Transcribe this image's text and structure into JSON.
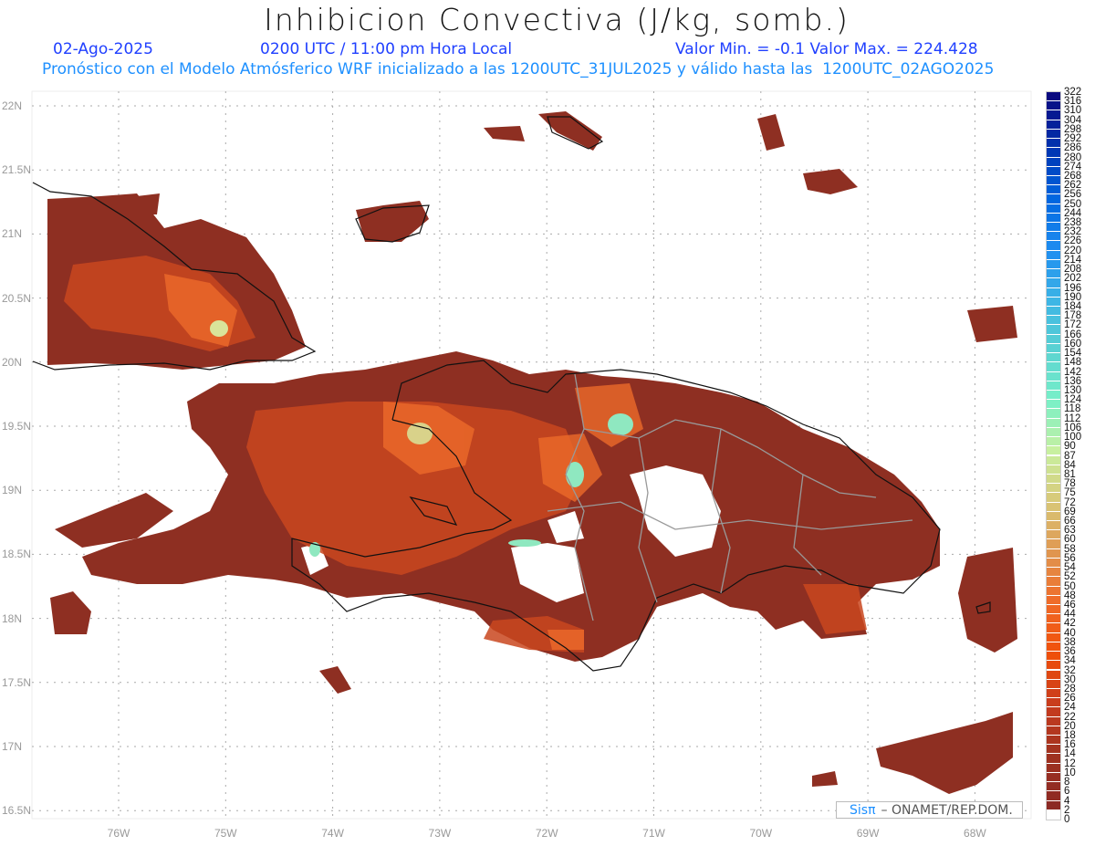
{
  "header": {
    "title": "Inhibicion Convectiva (J/kg, somb.)",
    "date": "02-Ago-2025",
    "time": "0200 UTC / 11:00 pm Hora Local",
    "min_max": "Valor Min. = -0.1  Valor Max. = 224.428",
    "subtitle": "Pronóstico con el Modelo Atmósferico WRF inicializado a las 1200UTC_31JUL2025 y válido hasta las  1200UTC_02AGO2025"
  },
  "axes": {
    "lat_labels": [
      "22N",
      "21.5N",
      "21N",
      "20.5N",
      "20N",
      "19.5N",
      "19N",
      "18.5N",
      "18N",
      "17.5N",
      "17N",
      "16.5N"
    ],
    "lon_labels": [
      "76W",
      "75W",
      "74W",
      "73W",
      "72W",
      "71W",
      "70W",
      "69W",
      "68W"
    ]
  },
  "colorbar": {
    "labels": [
      "322",
      "316",
      "310",
      "304",
      "298",
      "292",
      "286",
      "280",
      "274",
      "268",
      "262",
      "256",
      "250",
      "244",
      "238",
      "232",
      "226",
      "220",
      "214",
      "208",
      "202",
      "196",
      "190",
      "184",
      "178",
      "172",
      "166",
      "160",
      "154",
      "148",
      "142",
      "136",
      "130",
      "124",
      "118",
      "112",
      "106",
      "100",
      "90",
      "87",
      "84",
      "81",
      "78",
      "75",
      "72",
      "69",
      "66",
      "63",
      "60",
      "58",
      "56",
      "54",
      "52",
      "50",
      "48",
      "46",
      "44",
      "42",
      "40",
      "38",
      "36",
      "34",
      "32",
      "30",
      "28",
      "26",
      "24",
      "22",
      "20",
      "18",
      "16",
      "14",
      "12",
      "10",
      "8",
      "6",
      "4",
      "2",
      "0"
    ],
    "color_stops": [
      "#0a0a80",
      "#0033b0",
      "#0066e0",
      "#1e8cf0",
      "#3cb4e6",
      "#5ad2d2",
      "#78f0c8",
      "#c8f0a0",
      "#d8c878",
      "#e09650",
      "#f06a28",
      "#f0500a",
      "#c83c1e",
      "#a03220",
      "#8c2a24",
      "#ffffff"
    ]
  },
  "credit": {
    "logo": "Sisπ",
    "text": "– ONAMET/REP.DOM."
  },
  "colors": {
    "field_low": "#8e2f22",
    "field_mid": "#d5531f",
    "field_high": "#f06a28",
    "field_peak": "#7ff0cc"
  }
}
